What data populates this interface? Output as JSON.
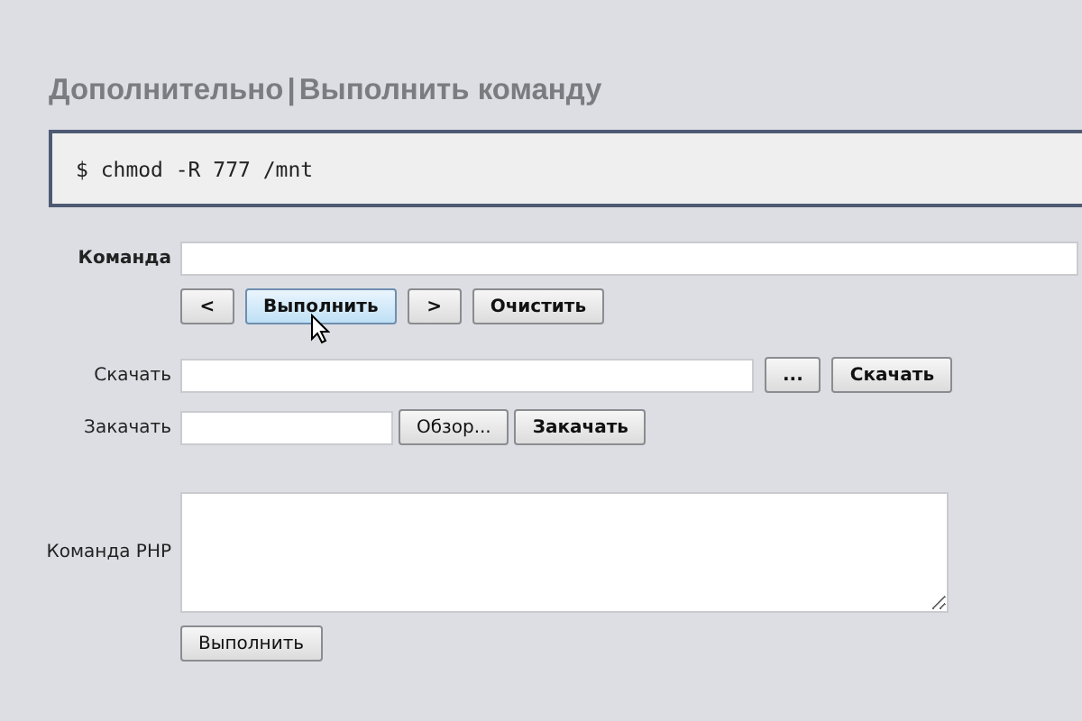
{
  "header": {
    "section": "Дополнительно",
    "separator": "|",
    "page": "Выполнить команду"
  },
  "console": {
    "output": "$ chmod -R 777 /mnt"
  },
  "command": {
    "label": "Команда",
    "buttons": [
      {
        "label": "<",
        "kind": "primary",
        "hovered": false
      },
      {
        "label": "Выполнить",
        "kind": "primary",
        "hovered": true
      },
      {
        "label": ">",
        "kind": "primary",
        "hovered": false
      },
      {
        "label": "Очистить",
        "kind": "primary",
        "hovered": false
      }
    ]
  },
  "download": {
    "label": "Скачать",
    "buttons": [
      {
        "label": "...",
        "kind": "primary",
        "hovered": false
      },
      {
        "label": "Скачать",
        "kind": "primary",
        "hovered": false
      }
    ]
  },
  "upload": {
    "label": "Закачать",
    "buttons": [
      {
        "label": "Обзор...",
        "kind": "plain",
        "hovered": false
      },
      {
        "label": "Закачать",
        "kind": "primary",
        "hovered": false
      }
    ]
  },
  "php": {
    "label": "Команда PHP",
    "buttons": [
      {
        "label": "Выполнить",
        "kind": "plain",
        "hovered": false
      }
    ]
  }
}
